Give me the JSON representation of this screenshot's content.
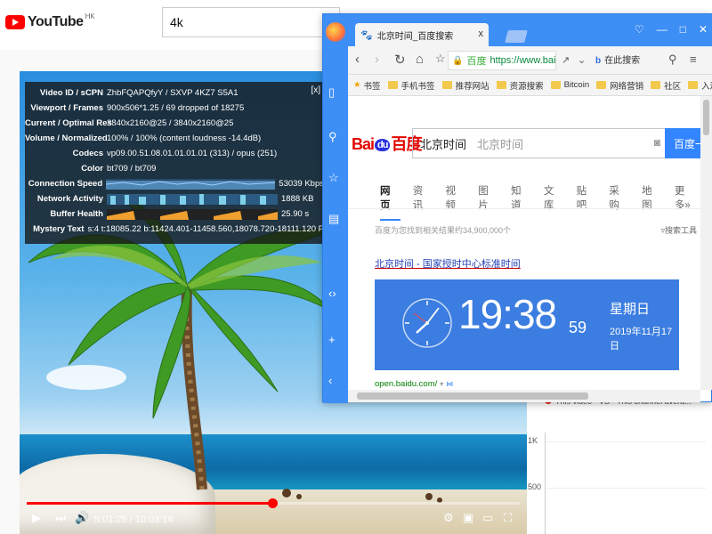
{
  "youtube": {
    "logo_text": "YouTube",
    "region": "HK",
    "search_value": "4k"
  },
  "stats": {
    "close_label": "[x]",
    "rows": [
      {
        "label": "Video ID / sCPN",
        "value": "ZhbFQAPQfyY / SXVP 4KZ7 S5A1"
      },
      {
        "label": "Viewport / Frames",
        "value": "900x506*1.25 / 69 dropped of 18275"
      },
      {
        "label": "Current / Optimal Res",
        "value": "3840x2160@25 / 3840x2160@25"
      },
      {
        "label": "Volume / Normalized",
        "value": "100% / 100% (content loudness -14.4dB)"
      },
      {
        "label": "Codecs",
        "value": "vp09.00.51.08.01.01.01.01 (313) / opus (251)"
      },
      {
        "label": "Color",
        "value": "bt709 / bt709"
      },
      {
        "label": "Connection Speed",
        "value": "53039 Kbps"
      },
      {
        "label": "Network Activity",
        "value": "1888 KB"
      },
      {
        "label": "Buffer Health",
        "value": "25.90 s"
      },
      {
        "label": "Mystery Text",
        "value": "s:4 t:18085.22 b:11424.401-11458.560,18078.720-18111.120 P"
      }
    ]
  },
  "player": {
    "current_time": "5:01:25",
    "duration": "10:03:16",
    "time_display": "5:01:25 / 10:03:16",
    "progress_fraction": 0.499
  },
  "right_panel": {
    "compare_this": "This video",
    "compare_vs": "VS",
    "compare_other": "This channel avera...",
    "axis_ticks": [
      "1K",
      "500"
    ]
  },
  "browser": {
    "tab_title": "北京时间_百度搜索",
    "tab_close": "x",
    "url_prefix": "百度",
    "url_host": "https://www.baidu",
    "search_here": "在此搜索",
    "bookmarks": [
      "书签",
      "手机书签",
      "推荐网站",
      "资源搜索",
      "Bitcoin",
      "网络营销",
      "社区",
      "入漠"
    ],
    "window_controls": [
      "♡",
      "—",
      "□",
      "✕"
    ]
  },
  "baidu": {
    "logo_bai": "Bai",
    "logo_du": "du",
    "logo_cn": "百度",
    "query": "北京时间",
    "placeholder_echo": "北京时间",
    "button_label": "百度一",
    "tabs": [
      "网页",
      "资讯",
      "视频",
      "图片",
      "知道",
      "文库",
      "贴吧",
      "采购",
      "地图",
      "更多»"
    ],
    "result_count": "百度为您找到相关结果约34,900,000个",
    "search_tools": "搜索工具",
    "result_title": "北京时间 - 国家授时中心标准时间",
    "clock_time": "19:38",
    "clock_seconds": "59",
    "clock_day": "星期日",
    "clock_date": "2019年11月17日",
    "result_url": "open.baidu.com/"
  }
}
